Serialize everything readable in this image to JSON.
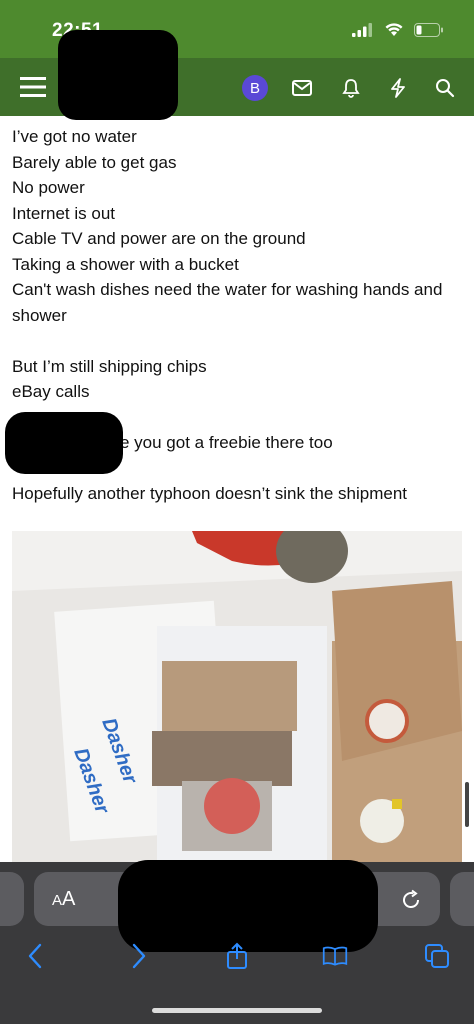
{
  "status_bar": {
    "time": "22:51"
  },
  "nav": {
    "avatar_letter": "B"
  },
  "post": {
    "lines": [
      "I’ve got no water",
      "Barely able to get gas",
      "No power",
      "Internet is out",
      "Cable TV and power are on the ground",
      "Taking a shower with a bucket",
      "Can't wash dishes need the water for washing hands and shower"
    ],
    "lines2": [
      "But I’m still shipping chips",
      "eBay calls"
    ],
    "partial_line": "e you got a freebie there too",
    "closing": "Hopefully another typhoon doesn’t sink the shipment"
  },
  "photo": {
    "brand_text": "Dasher"
  },
  "browser": {
    "text_size_label": "AA"
  },
  "colors": {
    "status_bar": "#4e8a2e",
    "nav_bar": "#3f6f2a",
    "avatar": "#5a49d6",
    "accent_blue": "#2e8cff"
  }
}
